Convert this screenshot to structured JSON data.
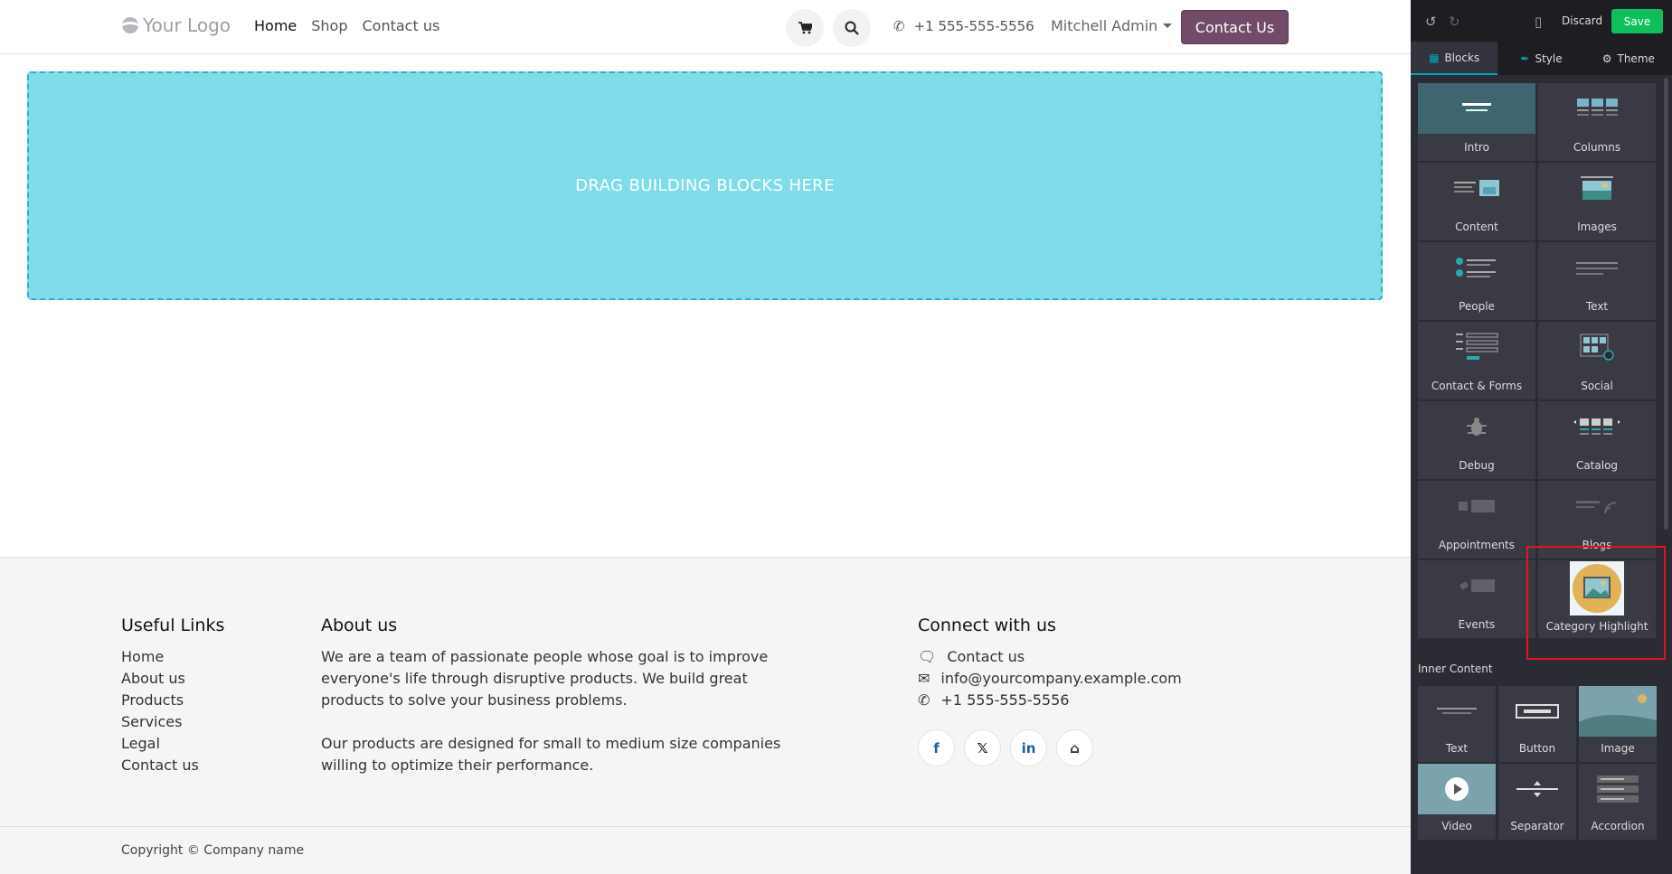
{
  "header": {
    "logo_text": "Your Logo",
    "nav": [
      "Home",
      "Shop",
      "Contact us"
    ],
    "phone": "+1 555-555-5556",
    "user": "Mitchell Admin",
    "cta_label": "Contact Us"
  },
  "dropzone": {
    "text": "DRAG BUILDING BLOCKS HERE"
  },
  "footer": {
    "useful_links_title": "Useful Links",
    "useful_links": [
      "Home",
      "About us",
      "Products",
      "Services",
      "Legal",
      "Contact us"
    ],
    "about_title": "About us",
    "about_p1": "We are a team of passionate people whose goal is to improve everyone's life through disruptive products. We build great products to solve your business problems.",
    "about_p2": "Our products are designed for small to medium size companies willing to optimize their performance.",
    "connect_title": "Connect with us",
    "connect_contact": "Contact us",
    "connect_email": "info@yourcompany.example.com",
    "connect_phone": "+1 555-555-5556",
    "copyright": "Copyright © Company name"
  },
  "editor": {
    "discard_label": "Discard",
    "save_label": "Save",
    "tabs": [
      "Blocks",
      "Style",
      "Theme"
    ],
    "blocks": [
      "Intro",
      "Columns",
      "Content",
      "Images",
      "People",
      "Text",
      "Contact & Forms",
      "Social",
      "Debug",
      "Catalog",
      "Appointments",
      "Blogs",
      "Events",
      "Category Highlight"
    ],
    "inner_content_title": "Inner Content",
    "inner_blocks": [
      "Text",
      "Button",
      "Image",
      "Video",
      "Separator",
      "Accordion"
    ],
    "colors": {
      "save": "#0fbf5b",
      "active_tab": "#01a8b4",
      "highlight": "#e0161e"
    }
  }
}
